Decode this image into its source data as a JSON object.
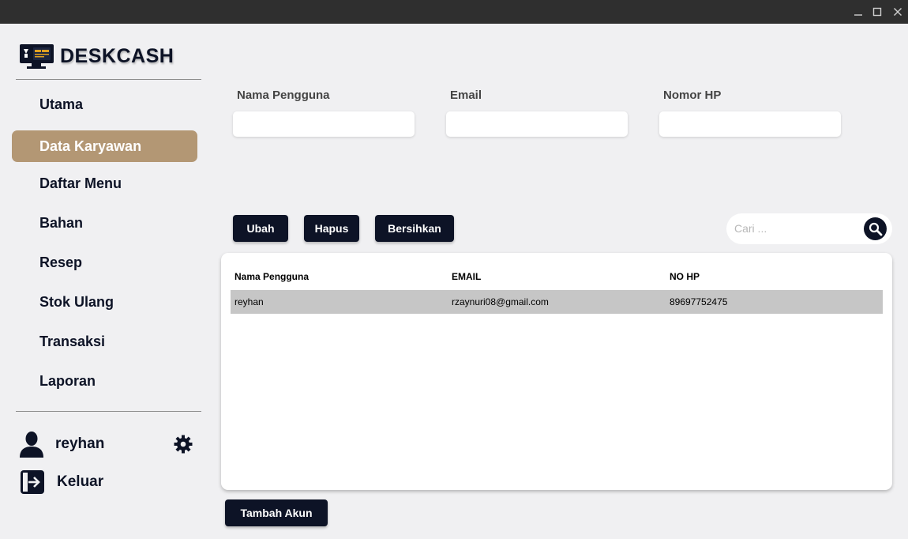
{
  "app": {
    "name": "DESKCASH"
  },
  "sidebar": {
    "items": [
      {
        "label": "Utama"
      },
      {
        "label": "Data Karyawan",
        "active": true
      },
      {
        "label": "Daftar Menu"
      },
      {
        "label": "Bahan"
      },
      {
        "label": "Resep"
      },
      {
        "label": "Stok Ulang"
      },
      {
        "label": "Transaksi"
      },
      {
        "label": "Laporan"
      }
    ],
    "user": {
      "name": "reyhan"
    },
    "logout_label": "Keluar"
  },
  "form": {
    "name_label": "Nama Pengguna",
    "name_value": "",
    "email_label": "Email",
    "email_value": "",
    "phone_label": "Nomor HP",
    "phone_value": ""
  },
  "actions": {
    "edit_label": "Ubah",
    "delete_label": "Hapus",
    "clear_label": "Bersihkan",
    "add_account_label": "Tambah Akun"
  },
  "search": {
    "placeholder": "Cari ...",
    "value": ""
  },
  "table": {
    "columns": [
      "Nama Pengguna",
      "EMAIL",
      "NO HP"
    ],
    "rows": [
      {
        "name": "reyhan",
        "email": "rzaynuri08@gmail.com",
        "phone": "89697752475",
        "selected": true
      }
    ]
  },
  "colors": {
    "primary": "#0d1326",
    "active_nav": "#b39774",
    "background": "#f0f0f2",
    "selected_row": "#c6c6c6"
  }
}
